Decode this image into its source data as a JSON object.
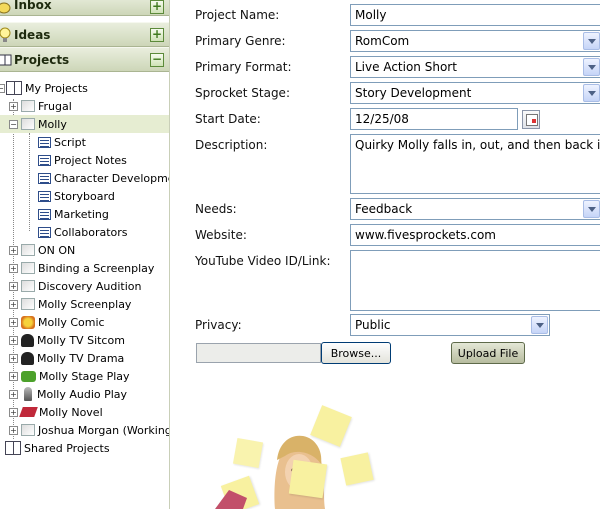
{
  "sidebar": {
    "sections": [
      {
        "label": "Inbox",
        "toggle": "+"
      },
      {
        "label": "Ideas",
        "toggle": "+"
      },
      {
        "label": "Projects",
        "toggle": "−"
      }
    ],
    "root": "My Projects",
    "shared": "Shared Projects",
    "projects": [
      {
        "label": "Frugal",
        "icon": "project-icon"
      },
      {
        "label": "Molly",
        "icon": "project-icon",
        "selected": true
      },
      {
        "label": "ON ON",
        "icon": "project-icon"
      },
      {
        "label": "Binding a Screenplay",
        "icon": "project-icon"
      },
      {
        "label": "Discovery Audition",
        "icon": "project-icon"
      },
      {
        "label": "Molly Screenplay",
        "icon": "project-icon"
      },
      {
        "label": "Molly Comic",
        "icon": "comic-icon"
      },
      {
        "label": "Molly TV Sitcom",
        "icon": "sitcom-icon"
      },
      {
        "label": "Molly TV Drama",
        "icon": "drama-icon"
      },
      {
        "label": "Molly Stage Play",
        "icon": "stage-play-icon"
      },
      {
        "label": "Molly Audio Play",
        "icon": "microphone-icon"
      },
      {
        "label": "Molly Novel",
        "icon": "book-icon"
      },
      {
        "label": "Joshua Morgan (Working Ti",
        "icon": "project-icon"
      }
    ],
    "molly_children": [
      "Script",
      "Project Notes",
      "Character Development",
      "Storyboard",
      "Marketing",
      "Collaborators"
    ]
  },
  "form": {
    "project_name": {
      "label": "Project Name:",
      "value": "Molly"
    },
    "primary_genre": {
      "label": "Primary Genre:",
      "value": "RomCom"
    },
    "primary_format": {
      "label": "Primary Format:",
      "value": "Live Action Short"
    },
    "sprocket_stage": {
      "label": "Sprocket Stage:",
      "value": "Story Development"
    },
    "start_date": {
      "label": "Start Date:",
      "value": "12/25/08"
    },
    "description": {
      "label": "Description:",
      "value": "Quirky Molly falls in, out, and then back in love"
    },
    "needs": {
      "label": "Needs:",
      "value": "Feedback"
    },
    "website": {
      "label": "Website:",
      "value": "www.fivesprockets.com"
    },
    "youtube": {
      "label": "YouTube Video ID/Link:",
      "value": ""
    },
    "privacy": {
      "label": "Privacy:",
      "value": "Public"
    },
    "browse_label": "Browse...",
    "upload_label": "Upload File"
  },
  "colors": {
    "header_top": "#e9eedd",
    "header_bottom": "#cdd6b8",
    "selection": "#e6edd2",
    "input_border": "#7f9db9",
    "toggle_green": "#3f7a1e"
  }
}
